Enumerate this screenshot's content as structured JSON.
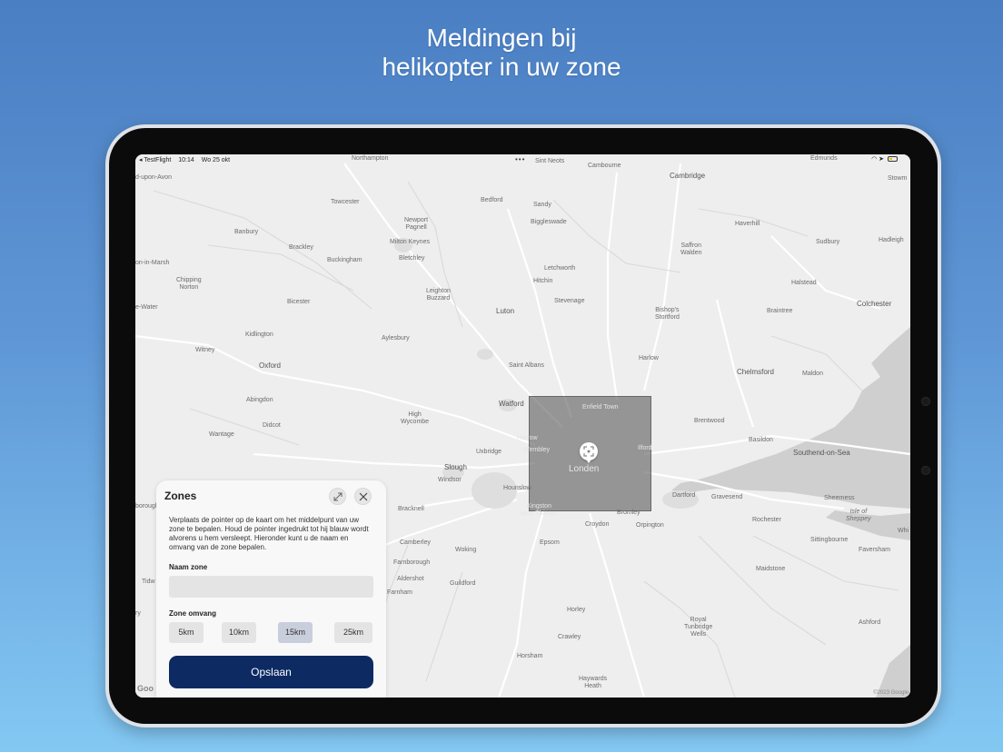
{
  "headline": {
    "line1": "Meldingen bij",
    "line2": "helikopter in uw zone"
  },
  "status_bar": {
    "back_app": "◂ TestFlight",
    "time": "10:14",
    "date": "Wo 25 okt",
    "dots": "•••"
  },
  "map": {
    "places": {
      "northampton": "Northampton",
      "upon_avon": "d-upon-Avon",
      "towcester": "Towcester",
      "bedford": "Bedford",
      "sandy": "Sandy",
      "st_neots": "Sint Neots",
      "cambourne": "Cambourne",
      "cambridge": "Cambridge",
      "edmunds": "Edmunds",
      "stowmarket": "Stowm",
      "newport_pagnell": "Newport\nPagnell",
      "biggleswade": "Biggleswade",
      "haverhill": "Haverhill",
      "banbury": "Banbury",
      "brackley": "Brackley",
      "milton_keynes": "Milton Keynes",
      "buckingham": "Buckingham",
      "bletchley": "Bletchley",
      "saffron_walden": "Saffron\nWalden",
      "sudbury": "Sudbury",
      "hadleigh": "Hadleigh",
      "in_marsh": "on-in-Marsh",
      "chipping_norton": "Chipping\nNorton",
      "letchworth": "Letchworth",
      "hitchin": "Hitchin",
      "halstead": "Halstead",
      "leighton_buzzard": "Leighton\nBuzzard",
      "bicester": "Bicester",
      "stevenage": "Stevenage",
      "colchester": "Colchester",
      "e_water": "e-Water",
      "luton": "Luton",
      "bishops_stortford": "Bishop's\nStortford",
      "braintree": "Braintree",
      "kidlington": "Kidlington",
      "aylesbury": "Aylesbury",
      "witney": "Witney",
      "harlow": "Harlow",
      "oxford": "Oxford",
      "saint_albans": "Saint Albans",
      "chelmsford": "Chelmsford",
      "maldon": "Maldon",
      "abingdon": "Abingdon",
      "watford": "Watford",
      "enfield_town": "Enfield Town",
      "high_wycombe": "High\nWycombe",
      "didcot": "Didcot",
      "brentwood": "Brentwood",
      "wantage": "Wantage",
      "harrow": "Harrow",
      "basildon": "Basildon",
      "uxbridge": "Uxbridge",
      "wembley": "Wembley",
      "ilford": "Ilford",
      "southend": "Southend-on-Sea",
      "slough": "Slough",
      "london": "Londen",
      "windsor": "Windsor",
      "hounslow": "Hounslow",
      "dartford": "Dartford",
      "gravesend": "Gravesend",
      "sheerness": "Sheerness",
      "borough": "borough",
      "bracknell": "Bracknell",
      "kingston": "Kingston\nupon Thames",
      "bromley": "Bromley",
      "rochester": "Rochester",
      "isle_of_sheppey": "Isle of\nSheppey",
      "croydon": "Croydon",
      "orpington": "Orpington",
      "camberley": "Camberley",
      "woking": "Woking",
      "epsom": "Epsom",
      "sittingbourne": "Sittingbourne",
      "faversham": "Faversham",
      "farnborough": "Farnborough",
      "whitstable": "Whi",
      "aldershot": "Aldershot",
      "guildford": "Guildford",
      "maidstone": "Maidstone",
      "tidworth": "Tidw",
      "farnham": "Farnham",
      "horley": "Horley",
      "ashford": "Ashford",
      "royal_tunbridge_wells": "Royal\nTunbridge\nWells",
      "crawley": "Crawley",
      "horsham": "Horsham",
      "haywards_heath": "Haywards\nHeath",
      "ry": "ry"
    },
    "google_logo": "Goo",
    "copyright": "©2023 Google"
  },
  "panel": {
    "title": "Zones",
    "description": "Verplaats de pointer op de kaart om het middelpunt van uw zone te bepalen. Houd de pointer ingedrukt tot hij blauw wordt alvorens u hem versleept. Hieronder kunt u de naam en omvang van de zone bepalen.",
    "name_label": "Naam zone",
    "name_value": "",
    "size_label": "Zone omvang",
    "sizes": [
      "5km",
      "10km",
      "15km",
      "25km"
    ],
    "selected_size": "15km",
    "save_label": "Opslaan"
  },
  "colors": {
    "save_button": "#0d2a63",
    "selected_size": "#c9cedc",
    "zone_overlay": "#555555"
  }
}
